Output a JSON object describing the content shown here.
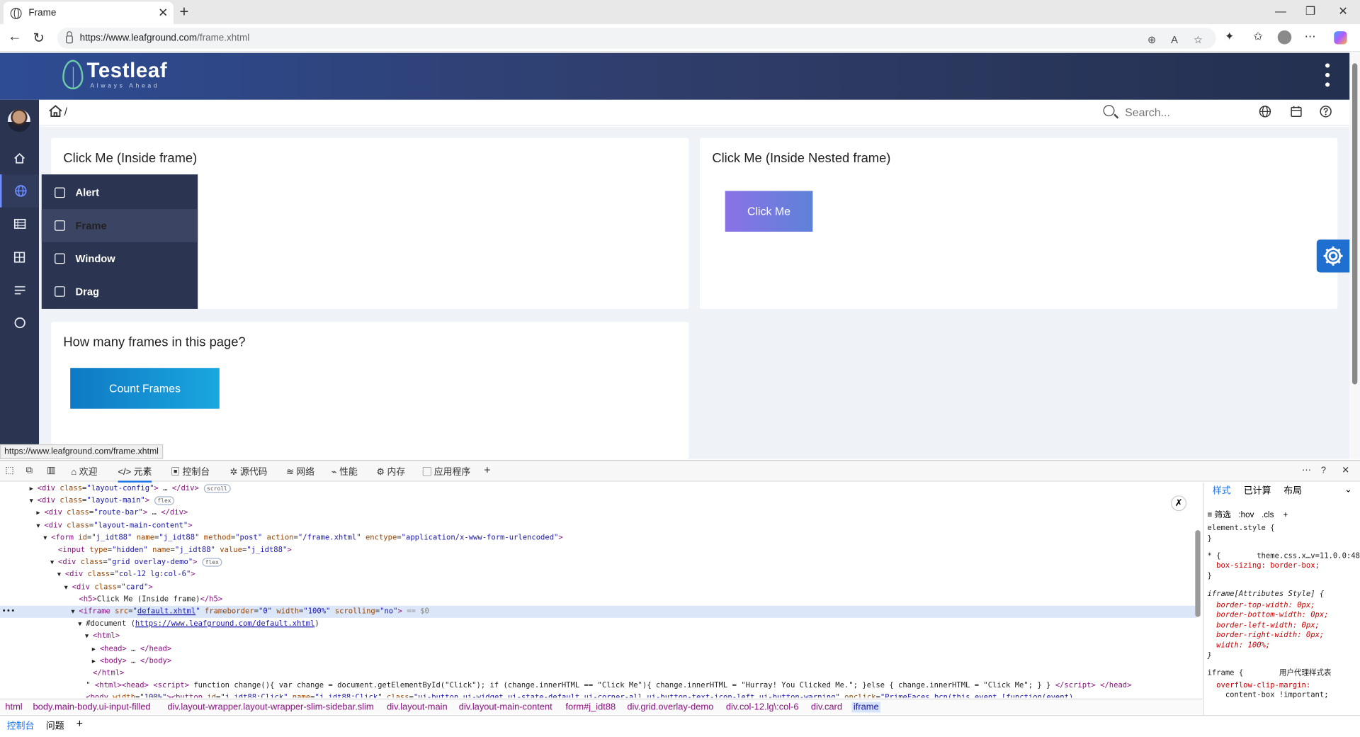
{
  "browser": {
    "tab_title": "Frame",
    "url_host": "https://www.leafground.com",
    "url_path": "/frame.xhtml",
    "status_url": "https://www.leafground.com/frame.xhtml"
  },
  "header": {
    "logo_text": "Testleaf",
    "logo_tagline": "Always Ahead"
  },
  "topbar": {
    "breadcrumb_sep": "/",
    "search_placeholder": "Search..."
  },
  "menu": {
    "items": [
      {
        "label": "Alert",
        "icon": "alert-icon"
      },
      {
        "label": "Frame",
        "icon": "frame-icon"
      },
      {
        "label": "Window",
        "icon": "window-icon"
      },
      {
        "label": "Drag",
        "icon": "drag-icon"
      }
    ],
    "selected": "Frame"
  },
  "cards": {
    "inside_frame_title": "Click Me (Inside frame)",
    "nested_frame_title": "Click Me (Inside Nested frame)",
    "nested_button_label": "Click Me",
    "count_title": "How many frames in this page?",
    "count_button_label": "Count Frames"
  },
  "devtools": {
    "tabs": [
      "欢迎",
      "元素",
      "控制台",
      "源代码",
      "网络",
      "性能",
      "内存",
      "应用程序"
    ],
    "active_tab": "元素",
    "code_lines": [
      {
        "indent": 3,
        "arrow": "▶",
        "html": "<span class=\"tag\">&lt;div</span> <span class=\"an\">class</span>=<span class=\"av\">\"layout-config\"</span><span class=\"tag\">&gt;</span> … <span class=\"tag\">&lt;/div&gt;</span> <span class=\"pill\">scroll</span>"
      },
      {
        "indent": 3,
        "arrow": "▼",
        "html": "<span class=\"tag\">&lt;div</span> <span class=\"an\">class</span>=<span class=\"av\">\"layout-main\"</span><span class=\"tag\">&gt;</span> <span class=\"pill\">flex</span>"
      },
      {
        "indent": 4,
        "arrow": "▶",
        "html": "<span class=\"tag\">&lt;div</span> <span class=\"an\">class</span>=<span class=\"av\">\"route-bar\"</span><span class=\"tag\">&gt;</span> … <span class=\"tag\">&lt;/div&gt;</span>"
      },
      {
        "indent": 4,
        "arrow": "▼",
        "html": "<span class=\"tag\">&lt;div</span> <span class=\"an\">class</span>=<span class=\"av\">\"layout-main-content\"</span><span class=\"tag\">&gt;</span>"
      },
      {
        "indent": 5,
        "arrow": "▼",
        "html": "<span class=\"tag\">&lt;form</span> <span class=\"an\">id</span>=<span class=\"av\">\"j_idt88\"</span> <span class=\"an\">name</span>=<span class=\"av\">\"j_idt88\"</span> <span class=\"an\">method</span>=<span class=\"av\">\"post\"</span> <span class=\"an\">action</span>=<span class=\"av\">\"/frame.xhtml\"</span> <span class=\"an\">enctype</span>=<span class=\"av\">\"application/x-www-form-urlencoded\"</span><span class=\"tag\">&gt;</span>"
      },
      {
        "indent": 6,
        "arrow": "",
        "html": "<span class=\"tag\">&lt;input</span> <span class=\"an\">type</span>=<span class=\"av\">\"hidden\"</span> <span class=\"an\">name</span>=<span class=\"av\">\"j_idt88\"</span> <span class=\"an\">value</span>=<span class=\"av\">\"j_idt88\"</span><span class=\"tag\">&gt;</span>"
      },
      {
        "indent": 6,
        "arrow": "▼",
        "html": "<span class=\"tag\">&lt;div</span> <span class=\"an\">class</span>=<span class=\"av\">\"grid overlay-demo\"</span><span class=\"tag\">&gt;</span> <span class=\"pill\">flex</span>"
      },
      {
        "indent": 7,
        "arrow": "▼",
        "html": "<span class=\"tag\">&lt;div</span> <span class=\"an\">class</span>=<span class=\"av\">\"col-12 lg:col-6\"</span><span class=\"tag\">&gt;</span>"
      },
      {
        "indent": 8,
        "arrow": "▼",
        "html": "<span class=\"tag\">&lt;div</span> <span class=\"an\">class</span>=<span class=\"av\">\"card\"</span><span class=\"tag\">&gt;</span>"
      },
      {
        "indent": 9,
        "arrow": "",
        "html": "<span class=\"tag\">&lt;h5&gt;</span>Click Me (Inside frame)<span class=\"tag\">&lt;/h5&gt;</span>"
      },
      {
        "indent": 9,
        "arrow": "▼",
        "hl": true,
        "html": "<span class=\"tag\">&lt;iframe</span> <span class=\"an\">src</span>=<span class=\"av\">\"<u>default.xhtml</u>\"</span> <span class=\"an\">frameborder</span>=<span class=\"av\">\"0\"</span> <span class=\"an\">width</span>=<span class=\"av\">\"100%\"</span> <span class=\"an\">scrolling</span>=<span class=\"av\">\"no\"</span><span class=\"tag\">&gt;</span> <span class=\"cm\">== $0</span>"
      },
      {
        "indent": 10,
        "arrow": "▼",
        "html": "#document (<span class=\"lk\">https://www.leafground.com/default.xhtml</span>)"
      },
      {
        "indent": 11,
        "arrow": "▼",
        "html": "<span class=\"tag\">&lt;html&gt;</span>"
      },
      {
        "indent": 12,
        "arrow": "▶",
        "html": "<span class=\"tag\">&lt;head&gt;</span> … <span class=\"tag\">&lt;/head&gt;</span>"
      },
      {
        "indent": 12,
        "arrow": "▶",
        "html": "<span class=\"tag\">&lt;body&gt;</span> … <span class=\"tag\">&lt;/body&gt;</span>"
      },
      {
        "indent": 11,
        "arrow": "",
        "html": "<span class=\"tag\">&lt;/html&gt;</span>"
      },
      {
        "indent": 10,
        "arrow": "",
        "html": "\" <span class=\"tag\">&lt;html&gt;&lt;head&gt;</span> <span class=\"tag\">&lt;script&gt;</span> function change(){ var change = document.getElementById(\"Click\"); if (change.innerHTML == \"Click Me\"){ change.innerHTML = \"Hurray! You Clicked Me.\"; }else { change.innerHTML = \"Click Me\"; } } <span class=\"tag\">&lt;/script&gt;</span> <span class=\"tag\">&lt;/head&gt;</span>"
      },
      {
        "indent": 10,
        "arrow": "",
        "html": "<span class=\"tag\">&lt;body</span> <span class=\"an\">width</span>=<span class=\"av\">\"100%\"</span><span class=\"tag\">&gt;&lt;button</span> <span class=\"an\">id</span>=<span class=\"av\">\"j_idt88:Click\"</span> <span class=\"an\">name</span>=<span class=\"av\">\"j_idt88:Click\"</span> <span class=\"an\">class</span>=<span class=\"av\">\"ui-button ui-widget ui-state-default ui-corner-all ui-button-text-icon-left ui-button-warning\"</span> <span class=\"an\">onclick</span>=<span class=\"av\">\"PrimeFaces.bcn(this,event,[function(event)</span>"
      }
    ],
    "breadcrumbs": [
      "html",
      "body.main-body.ui-input-filled",
      "div.layout-wrapper.layout-wrapper-slim-sidebar.slim",
      "div.layout-main",
      "div.layout-main-content",
      "form#j_idt88",
      "div.grid.overlay-demo",
      "div.col-12.lg\\:col-6",
      "div.card",
      "iframe"
    ],
    "drawer_tabs": [
      "控制台",
      "问题"
    ],
    "styles_tabs": [
      "样式",
      "已计算",
      "布局"
    ],
    "styles_filter": "筛选",
    "styles_hov": ":hov",
    "styles_cls": ".cls",
    "styles_lines": [
      {
        "kind": "sel",
        "text": "element.style {"
      },
      {
        "kind": "sel",
        "text": "}"
      },
      {
        "kind": "sel",
        "text": "* {        theme.css.x…v=11.0.0:48"
      },
      {
        "kind": "prop",
        "text": "  box-sizing: border-box;"
      },
      {
        "kind": "sel",
        "text": "}"
      },
      {
        "kind": "sel",
        "text": "iframe[Attributes Style] {"
      },
      {
        "kind": "prop",
        "text": "  border-top-width: 0px;"
      },
      {
        "kind": "prop",
        "text": "  border-bottom-width: 0px;"
      },
      {
        "kind": "prop",
        "text": "  border-left-width: 0px;"
      },
      {
        "kind": "prop",
        "text": "  border-right-width: 0px;"
      },
      {
        "kind": "prop",
        "text": "  width: 100%;"
      },
      {
        "kind": "sel",
        "text": "}"
      },
      {
        "kind": "sel",
        "text": "iframe {        用户代理样式表"
      },
      {
        "kind": "prop",
        "text": "  overflow-clip-margin:"
      },
      {
        "kind": "sel",
        "text": "    content-box !important;"
      }
    ]
  },
  "colors": {
    "header_start": "#2e4c94",
    "sidebar": "#2b3551",
    "accent": "#1e6fd0",
    "content_bg": "#eff3f8"
  }
}
